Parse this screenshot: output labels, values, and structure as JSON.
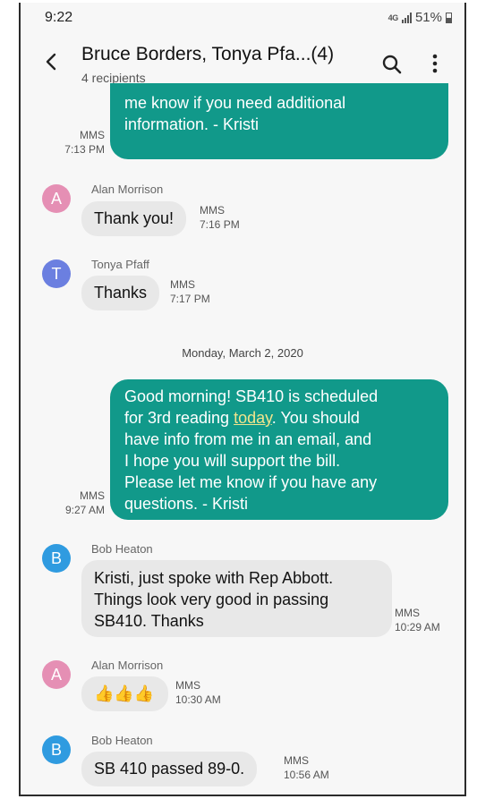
{
  "status_bar": {
    "time": "9:22",
    "network": "4G",
    "battery": "51%"
  },
  "header": {
    "title": "Bruce Borders, Tonya Pfa...(4)",
    "subtitle": "4 recipients"
  },
  "colors": {
    "outgoing_bubble": "#11998a",
    "incoming_bubble": "#e8e8e8",
    "avatar_alan": "#e58fb4",
    "avatar_tonya": "#6b7fe0",
    "avatar_bob": "#2f9be0"
  },
  "messages": [
    {
      "direction": "out",
      "lines": [
        "me know if you need additional",
        "information. - Kristi"
      ],
      "type": "MMS",
      "time": "7:13 PM"
    },
    {
      "direction": "in",
      "sender": "Alan Morrison",
      "initial": "A",
      "text": "Thank you!",
      "type": "MMS",
      "time": "7:16 PM"
    },
    {
      "direction": "in",
      "sender": "Tonya Pfaff",
      "initial": "T",
      "text": "Thanks",
      "type": "MMS",
      "time": "7:17 PM"
    },
    {
      "date_separator": "Monday, March 2, 2020"
    },
    {
      "direction": "out",
      "line1_before": "Good morning! SB410 is scheduled",
      "line2_before": "for 3rd reading ",
      "line2_link": "today",
      "line2_after": ". You should",
      "line3": "have info from me in an email, and",
      "line4": "I hope you will support the bill.",
      "line5": "Please let me know if you have any",
      "line6": "questions. - Kristi",
      "type": "MMS",
      "time": "9:27 AM"
    },
    {
      "direction": "in",
      "sender": "Bob Heaton",
      "initial": "B",
      "lines": [
        "Kristi, just spoke with Rep Abbott.",
        "Things look very good in passing",
        "SB410. Thanks"
      ],
      "type": "MMS",
      "time": "10:29 AM"
    },
    {
      "direction": "in",
      "sender": "Alan Morrison",
      "initial": "A",
      "text": "👍👍👍",
      "type": "MMS",
      "time": "10:30 AM"
    },
    {
      "direction": "in",
      "sender": "Bob Heaton",
      "initial": "B",
      "text": "SB 410 passed 89-0.",
      "type": "MMS",
      "time": "10:56 AM"
    }
  ]
}
